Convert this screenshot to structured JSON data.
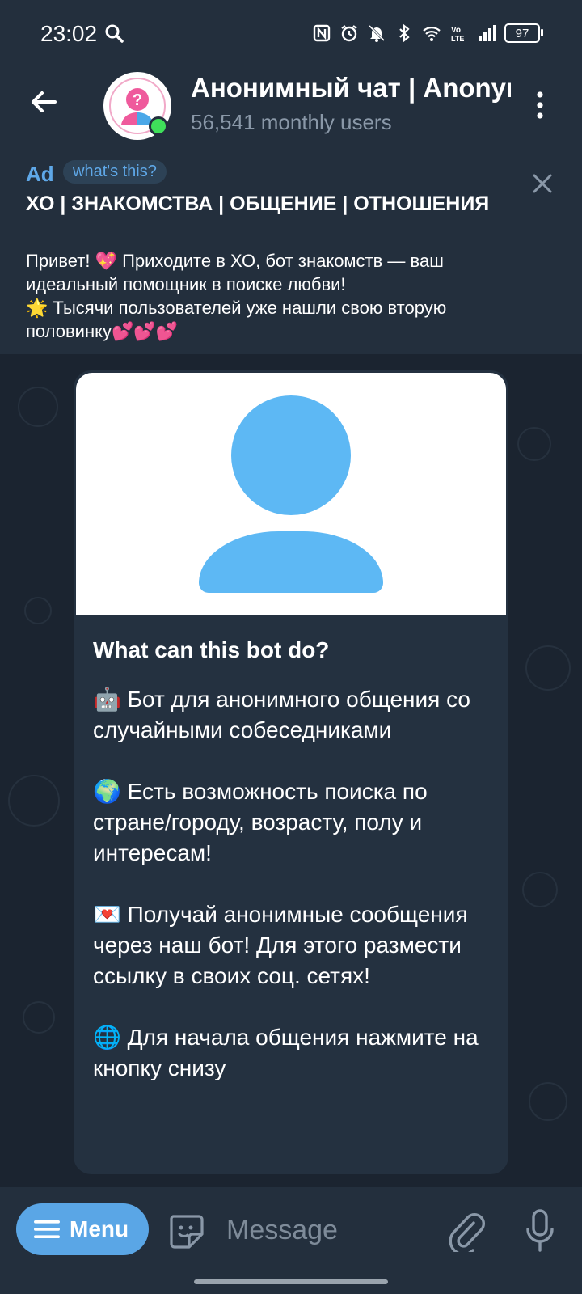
{
  "status_bar": {
    "time": "23:02",
    "battery": "97",
    "icons": [
      "search-icon",
      "nfc-icon",
      "alarm-icon",
      "bell-off-icon",
      "bluetooth-icon",
      "wifi-icon",
      "volte-icon",
      "signal-icon",
      "battery-icon"
    ]
  },
  "header": {
    "title": "Анонимный чат | Anonymous chat",
    "subtitle": "56,541 monthly users"
  },
  "ad": {
    "label": "Ad",
    "whats_this": "what's this?",
    "title": "ХО | ЗНАКОМСТВА | ОБЩЕНИЕ | ОТНОШЕНИЯ",
    "text": "Привет! 💖 Приходите в ХО, бот знакомств — ваш идеальный помощник в поиске любви!\n🌟 Тысячи пользователей уже нашли свою вторую половинку💕💕💕"
  },
  "bot_card": {
    "heading": "What can this bot do?",
    "description": "🤖 Бот для анонимного общения со случайными собеседниками\n\n🌍 Есть возможность поиска по стране/городу, возрасту, полу и интересам!\n\n💌 Получай анонимные сообщения через наш бот! Для этого размести ссылку в своих соц. сетях!\n\n🌐 Для начала общения нажмите на кнопку снизу"
  },
  "input_bar": {
    "menu_label": "Menu",
    "placeholder": "Message"
  },
  "colors": {
    "background": "#1d2733",
    "header": "#232f3d",
    "accent": "#5aa6e6",
    "card": "#243140",
    "online": "#3fe05a"
  }
}
